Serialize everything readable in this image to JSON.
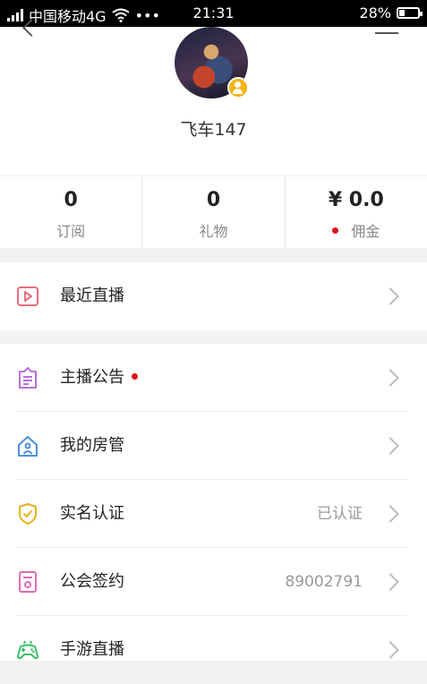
{
  "status_bar": {
    "carrier": "中国移动4G",
    "dots": "•••",
    "time": "21:31",
    "battery": "28%",
    "battery_level": 0.28
  },
  "profile": {
    "username": "飞车147"
  },
  "stats": [
    {
      "value": "0",
      "label": "订阅"
    },
    {
      "value": "0",
      "label": "礼物"
    },
    {
      "value": "¥ 0.0",
      "label": "佣金"
    }
  ],
  "menu": {
    "recent_live": {
      "label": "最近直播",
      "icon": "play-icon"
    },
    "announcement": {
      "label": "主播公告",
      "icon": "notice-icon"
    },
    "room_admin": {
      "label": "我的房管",
      "icon": "house-user-icon"
    },
    "realname": {
      "label": "实名认证",
      "value": "已认证",
      "icon": "shield-check-icon"
    },
    "guild": {
      "label": "公会签约",
      "value": "89002791",
      "icon": "contract-icon"
    },
    "mobile_game": {
      "label": "手游直播",
      "icon": "gamepad-icon"
    }
  },
  "colors": {
    "accent_red": "#e0101a",
    "icon_pink": "#e86c7d",
    "icon_purple": "#b96fd8",
    "icon_blue": "#4a90d9",
    "icon_gold": "#e8b21a",
    "icon_magenta": "#e06bb0",
    "icon_green": "#3bbf6a"
  }
}
